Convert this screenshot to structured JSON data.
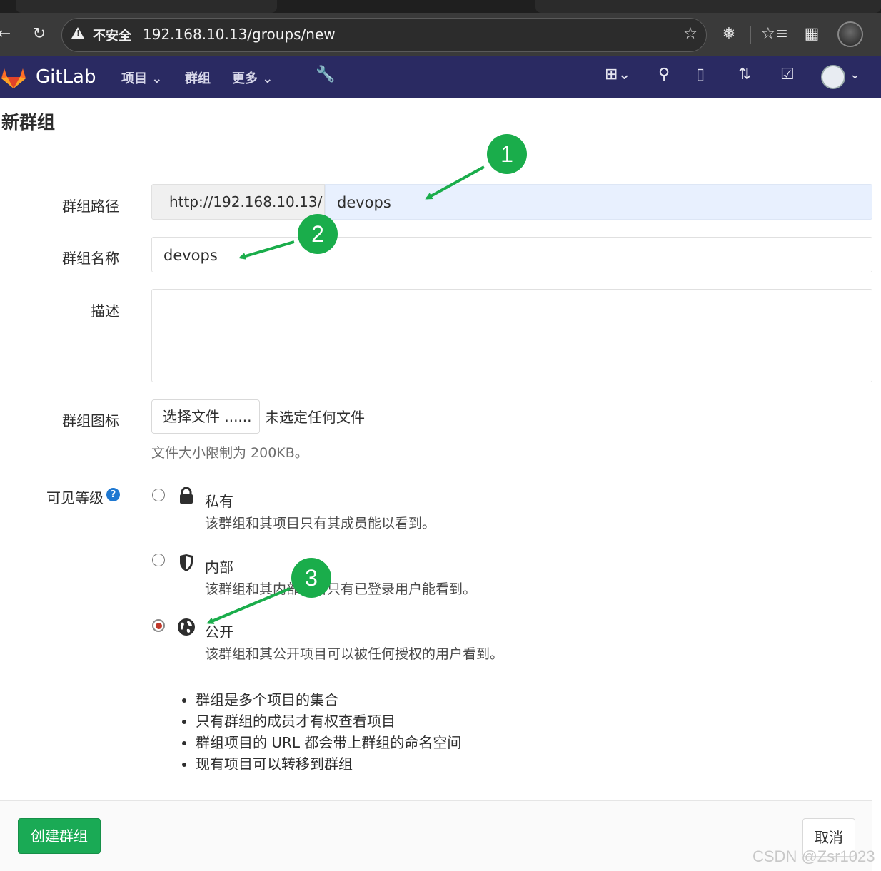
{
  "browser": {
    "security_label": "不安全",
    "url": "192.168.10.13/groups/new"
  },
  "gitlab_nav": {
    "brand": "GitLab",
    "links": [
      "项目",
      "群组",
      "更多"
    ]
  },
  "page": {
    "title": "新群组",
    "fields": {
      "path_label": "群组路径",
      "path_prefix": "http://192.168.10.13/",
      "path_value": "devops",
      "name_label": "群组名称",
      "name_value": "devops",
      "description_label": "描述",
      "description_value": "",
      "avatar_label": "群组图标",
      "choose_file_label": "选择文件 ......",
      "no_file_text": "未选定任何文件",
      "file_size_hint": "文件大小限制为 200KB。"
    },
    "visibility": {
      "label": "可见等级",
      "selected": "public",
      "options": [
        {
          "id": "private",
          "title": "私有",
          "description": "该群组和其项目只有其成员能以看到。",
          "icon": "lock-icon"
        },
        {
          "id": "internal",
          "title": "内部",
          "description": "该群组和其内部项目只有已登录用户能看到。",
          "icon": "shield-icon"
        },
        {
          "id": "public",
          "title": "公开",
          "description": "该群组和其公开项目可以被任何授权的用户看到。",
          "icon": "globe-icon"
        }
      ]
    },
    "benefits": [
      "群组是多个项目的集合",
      "只有群组的成员才有权查看项目",
      "群组项目的 URL 都会带上群组的命名空间",
      "现有项目可以转移到群组"
    ],
    "buttons": {
      "create": "创建群组",
      "cancel": "取消"
    }
  },
  "annotations": {
    "callouts": [
      "1",
      "2",
      "3"
    ],
    "color": "#1aad4b"
  },
  "watermark": "CSDN @Zsr1023",
  "colors": {
    "nav_bg": "#2a2a62",
    "create_button": "#1aaa55",
    "selected_radio": "#c0392b",
    "help_icon": "#1f78d1"
  }
}
